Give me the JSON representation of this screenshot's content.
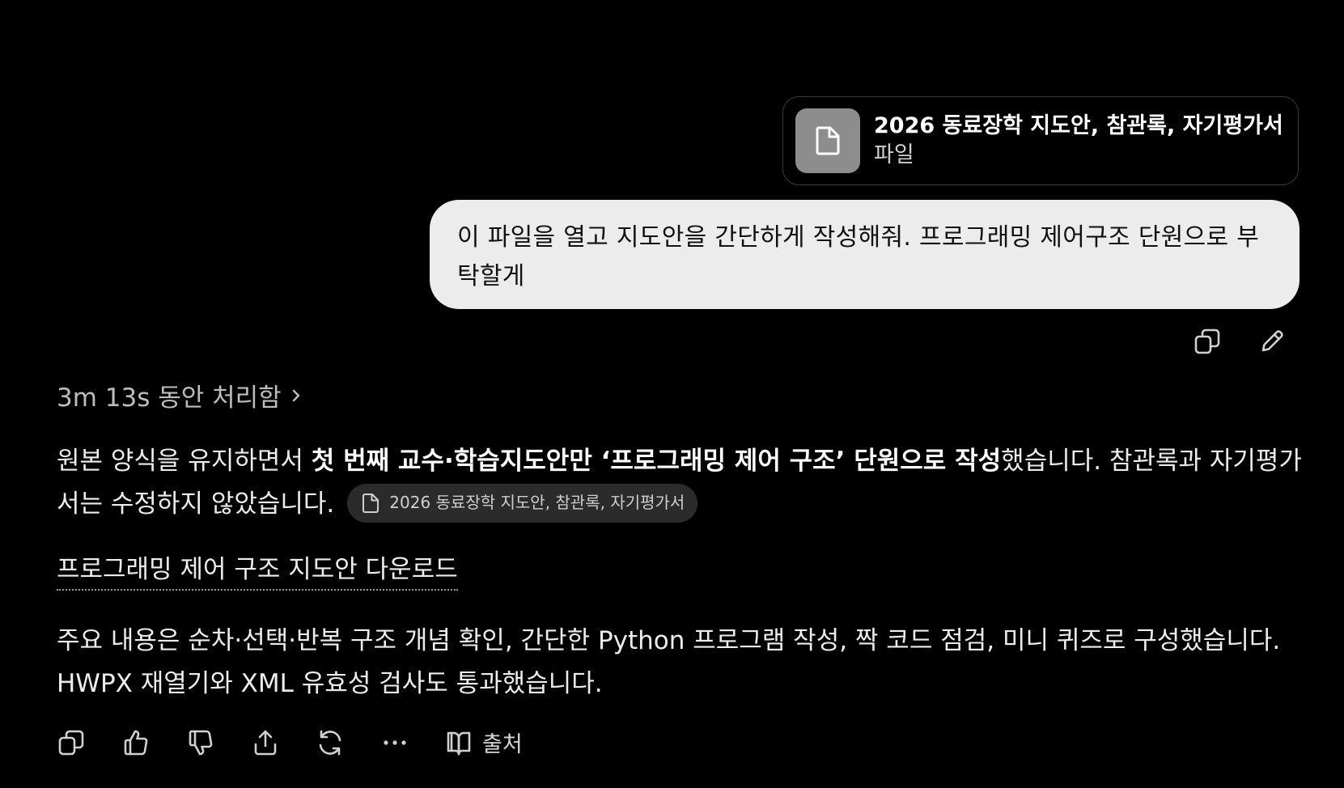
{
  "attachment": {
    "title": "2026 동료장학 지도안, 참관록, 자기평가서",
    "type_label": "파일",
    "icon": "file-icon"
  },
  "user_message": {
    "text": "이 파일을 열고 지도안을 간단하게 작성해줘. 프로그래밍 제어구조 단원으로 부탁할게",
    "actions": [
      "copy-icon",
      "edit-icon"
    ]
  },
  "assistant": {
    "thinking_label": "3m 13s 동안 처리함",
    "para1": {
      "text_before": "원본 양식을 유지하면서 ",
      "bold": "첫 번째 교수·학습지도안만 ‘프로그래밍 제어 구조’ 단원으로 작성",
      "text_after": "했습니다. 참관록과 자기평가서는 수정하지 않았습니다."
    },
    "citation_chip": "2026 동료장학 지도안, 참관록, 자기평가서",
    "download_link": "프로그래밍 제어 구조 지도안 다운로드",
    "para2": "주요 내용은 순차·선택·반복 구조 개념 확인, 간단한 Python 프로그램 작성, 짝 코드 점검, 미니 퀴즈로 구성했습니다. HWPX 재열기와 XML 유효성 검사도 통과했습니다.",
    "actions": [
      "copy-icon",
      "thumbs-up-icon",
      "thumbs-down-icon",
      "share-icon",
      "regenerate-icon",
      "more-icon"
    ],
    "sources_label": "출처"
  },
  "colors": {
    "background": "#000000",
    "user_bubble": "#ececec",
    "file_icon_bg": "#8d8d8d",
    "chip_bg": "#2b2b2b",
    "text": "#ececec"
  }
}
